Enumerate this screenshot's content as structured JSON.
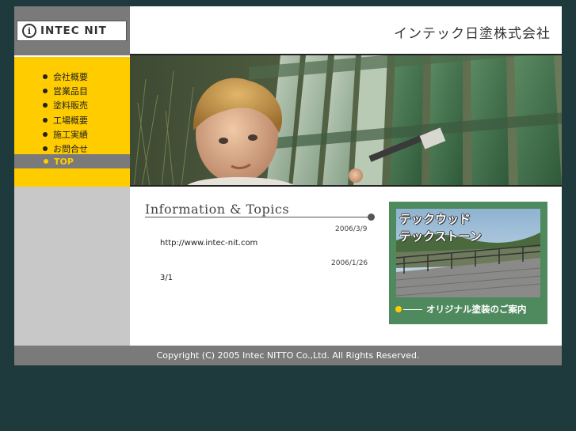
{
  "brand": {
    "logo_text": "INTEC NIT",
    "company_name": "インテック日塗株式会社"
  },
  "menu": {
    "items": [
      {
        "label": "会社概要"
      },
      {
        "label": "営業品目"
      },
      {
        "label": "塗料販売"
      },
      {
        "label": "工場概要"
      },
      {
        "label": "施工実績"
      },
      {
        "label": "お問合せ"
      }
    ],
    "current": {
      "label": "TOP"
    }
  },
  "info": {
    "title": "Information & Topics",
    "news": [
      {
        "date": "2006/3/9",
        "text": "http://www.intec-nit.com"
      },
      {
        "date": "2006/1/26",
        "text": "3/1"
      }
    ]
  },
  "banner": {
    "headline_line1": "テックウッド",
    "headline_line2": "テックストーン",
    "cta": "オリジナル塗装のご案内"
  },
  "footer": {
    "copyright": "Copyright (C) 2005 Intec NITTO Co.,Ltd. All Rights Reserved."
  },
  "colors": {
    "background": "#1f3a3c",
    "menu_yellow": "#ffcc00",
    "gray": "#7a7a7a",
    "banner_green": "#4f8a5e"
  }
}
